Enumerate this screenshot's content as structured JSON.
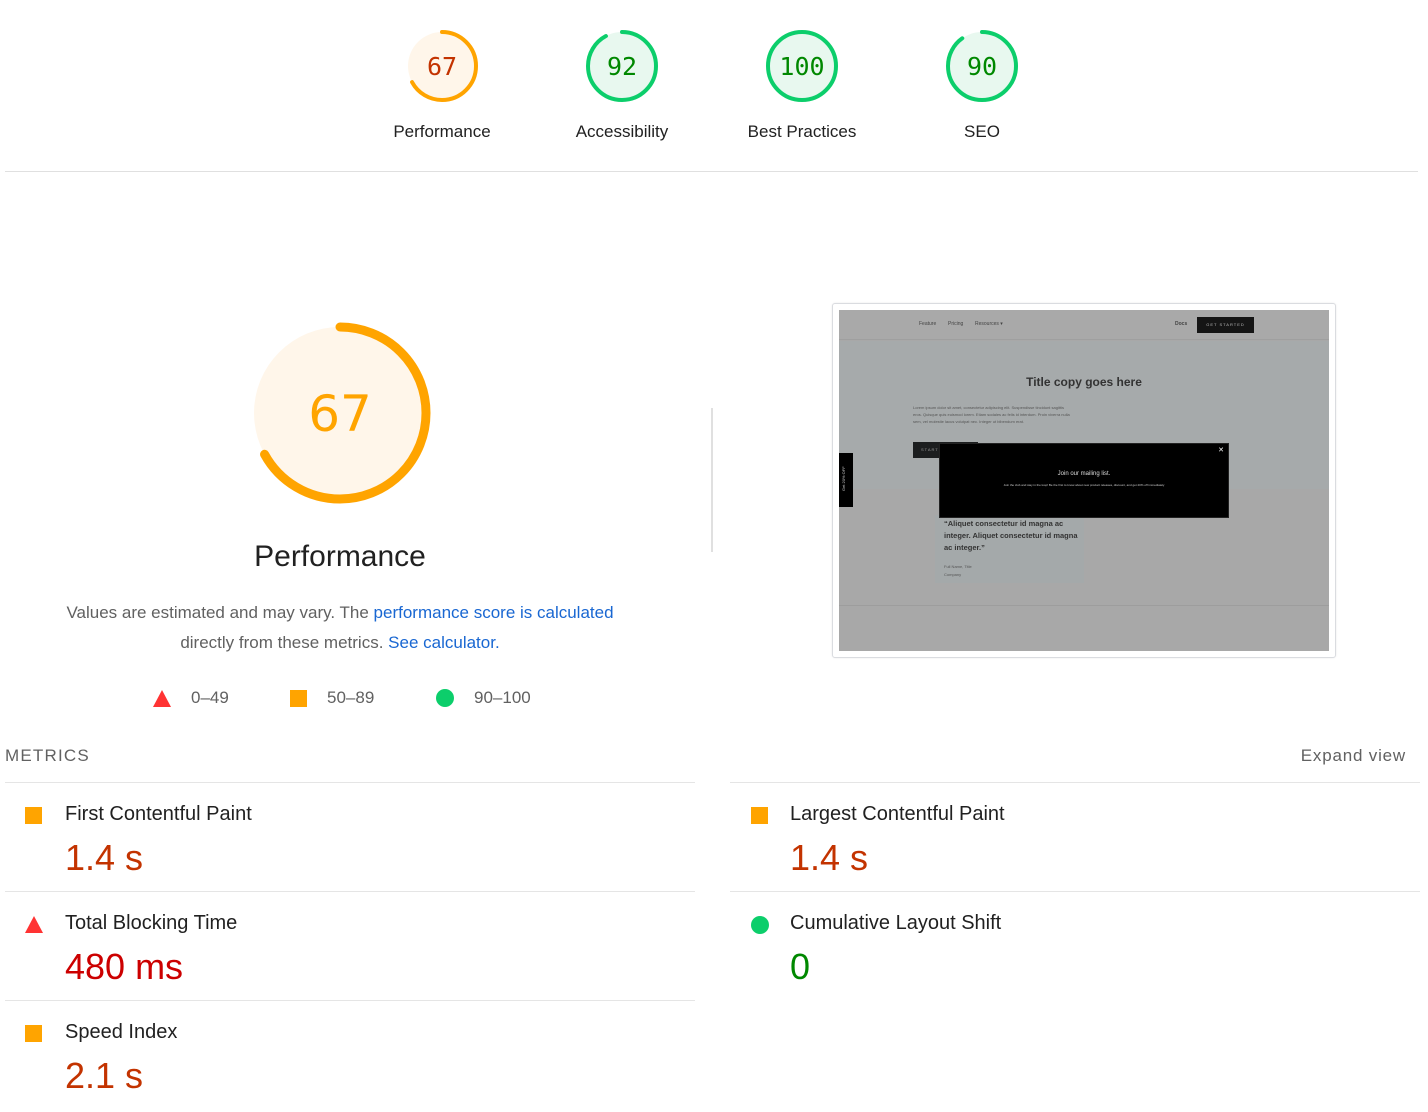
{
  "categories": [
    {
      "label": "Performance",
      "score": 67,
      "rating": "average"
    },
    {
      "label": "Accessibility",
      "score": 92,
      "rating": "pass"
    },
    {
      "label": "Best Practices",
      "score": 100,
      "rating": "pass"
    },
    {
      "label": "SEO",
      "score": 90,
      "rating": "pass"
    }
  ],
  "colors": {
    "average": "#ffa400",
    "average_text": "#c33300",
    "average_bg": "#fff6ea",
    "pass": "#0cce6b",
    "pass_text": "#008800",
    "pass_bg": "#e8f8ef",
    "fail": "#ff3333",
    "fail_text": "#cc0000",
    "link": "#1967d2"
  },
  "performance": {
    "score": 67,
    "title": "Performance",
    "desc_before": "Values are estimated and may vary. The ",
    "desc_link1": "performance score is calculated",
    "desc_middle": " directly from these metrics. ",
    "desc_link2": "See calculator."
  },
  "legend": [
    {
      "icon": "triangle-icon",
      "range": "0–49"
    },
    {
      "icon": "square-icon",
      "range": "50–89"
    },
    {
      "icon": "circle-icon",
      "range": "90–100"
    }
  ],
  "screenshot": {
    "nav_links": [
      "Feature",
      "Pricing",
      "Resources ▾"
    ],
    "nav_docs": "Docs",
    "nav_cta": "GET STARTED",
    "hero_title": "Title copy goes here",
    "hero_text": "Lorem ipsum dolor sit amet, consectetur adipiscing elit. Suspendisse tincidunt sagittis eros. Quisque quis euismod lorem. Etiam sodales ac felis id interdum. Proin viverra nulla sem, vel molestie lacus volutpat nec. Integer ut bibendum erat.",
    "hero_button": "START",
    "side_tab": "Get 20% OFF",
    "modal_title": "Join our mailing list.",
    "modal_text": "Join the club and stay in the loop! Be the first to know about new product releases, discount, and get 20% off immediately",
    "modal_close": "✕",
    "quote": "“Aliquet consectetur id magna ac integer. Aliquet consectetur id magna ac integer.”",
    "quote_name": "Full Name, Title",
    "quote_company": "Company"
  },
  "metrics": {
    "heading": "METRICS",
    "expand": "Expand view",
    "left": [
      {
        "name": "First Contentful Paint",
        "value": "1.4 s",
        "rating": "average"
      },
      {
        "name": "Total Blocking Time",
        "value": "480 ms",
        "rating": "fail"
      },
      {
        "name": "Speed Index",
        "value": "2.1 s",
        "rating": "average"
      }
    ],
    "right": [
      {
        "name": "Largest Contentful Paint",
        "value": "1.4 s",
        "rating": "average"
      },
      {
        "name": "Cumulative Layout Shift",
        "value": "0",
        "rating": "pass"
      }
    ]
  }
}
